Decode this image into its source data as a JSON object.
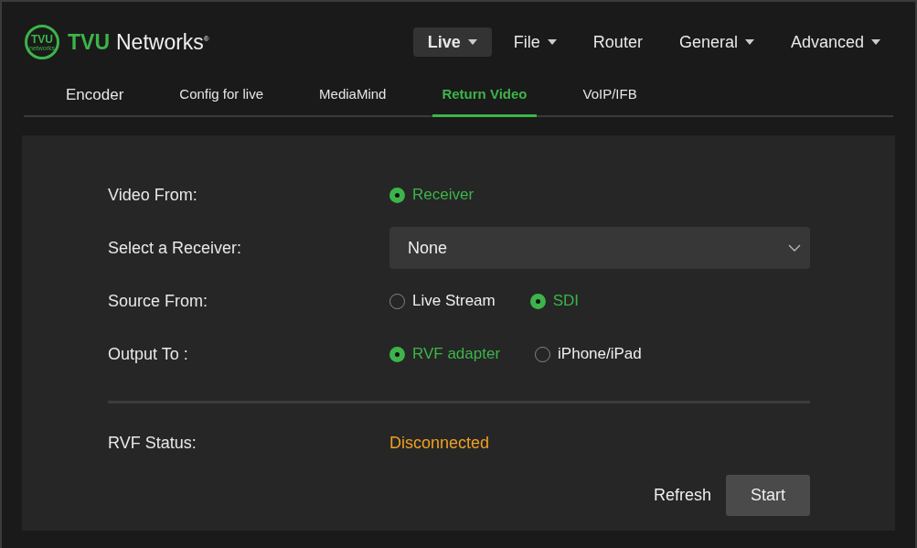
{
  "logo": {
    "mark": "TVU",
    "sub": "networks"
  },
  "brand": {
    "highlight": "TVU",
    "name": "Networks$^{®}$"
  },
  "nav": [
    {
      "label": "Live",
      "selected": true,
      "dropdown": true
    },
    {
      "label": "File",
      "selected": false,
      "dropdown": true
    },
    {
      "label": "Router",
      "selected": false,
      "dropdown": false
    },
    {
      "label": "General",
      "selected": false,
      "dropdown": true
    },
    {
      "label": "Advanced",
      "selected": false,
      "dropdown": true
    }
  ],
  "tabs": [
    {
      "label": "Encoder",
      "selected": false
    },
    {
      "label": "Config for live",
      "selected": false
    },
    {
      "label": "MediaMind",
      "selected": false
    },
    {
      "label": "Return Video",
      "selected": true
    },
    {
      "label": "VoIP/IFB",
      "selected": false
    }
  ],
  "form": [
    {
      "kind": "radio",
      "label": "Video From:",
      "options": [
        {
          "label": "Receiver",
          "selected": true
        }
      ]
    },
    {
      "kind": "select",
      "label": "Select a Receiver:",
      "value": "None"
    },
    {
      "kind": "radio",
      "label": "Source From:",
      "options": [
        {
          "label": "Live Stream",
          "selected": false
        },
        {
          "label": "SDI",
          "selected": true
        }
      ]
    },
    {
      "kind": "radio",
      "label": "Output To :",
      "options": [
        {
          "label": "RVF adapter",
          "selected": true
        },
        {
          "label": "iPhone/iPad",
          "selected": false
        }
      ]
    }
  ],
  "status": {
    "label": "RVF Status:",
    "value": "Disconnected",
    "color": "#f0a020"
  },
  "buttons": [
    {
      "label": "Refresh",
      "kind": "text"
    },
    {
      "label": "Start",
      "kind": "filled"
    }
  ]
}
